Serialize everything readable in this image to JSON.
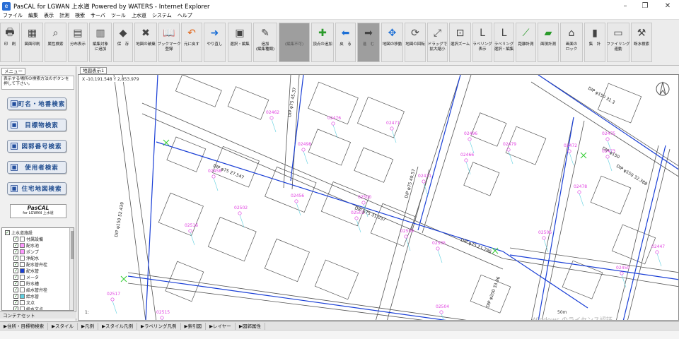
{
  "window": {
    "title": "PasCAL for LGWAN 上水道 Powered by WATERS - Internet Explorer",
    "controls": [
      "minimize-button",
      "restore-button",
      "close-button"
    ]
  },
  "menu": [
    "ファイル",
    "編集",
    "表示",
    "計測",
    "検索",
    "サーバ",
    "ツール",
    "上水道",
    "システム",
    "ヘルプ"
  ],
  "toolbar": [
    {
      "id": "print",
      "label": "印　刷",
      "icon": "printer-icon"
    },
    {
      "id": "mapprint",
      "label": "図面印刷",
      "icon": "map-print-icon"
    },
    {
      "id": "attr",
      "label": "属性検索",
      "icon": "attribute-search-icon"
    },
    {
      "id": "dist",
      "label": "分布表示",
      "icon": "distribution-icon"
    },
    {
      "id": "editadd",
      "label": "編集対象\nに追加",
      "icon": "edit-target-icon"
    },
    {
      "id": "save",
      "label": "保　存",
      "icon": "save-icon"
    },
    {
      "id": "clearmap",
      "label": "地図の破棄",
      "icon": "clear-map-icon"
    },
    {
      "id": "bookmark",
      "label": "ブックマーク\n登録",
      "icon": "bookmark-icon"
    },
    {
      "id": "undo",
      "label": "元に戻す",
      "icon": "undo-icon"
    },
    {
      "id": "redo",
      "label": "やり直し",
      "icon": "redo-icon"
    },
    {
      "id": "selectedit",
      "label": "選択・編集",
      "icon": "select-edit-icon"
    },
    {
      "id": "addedit",
      "label": "追加\n(編集種類)",
      "icon": "add-edit-icon"
    },
    {
      "id": "dis1",
      "label": "(編集不可)",
      "icon": "disabled-icon"
    },
    {
      "id": "vertex",
      "label": "頂点の追加",
      "icon": "add-vertex-icon"
    },
    {
      "id": "back",
      "label": "戻　る",
      "icon": "back-arrow-icon"
    },
    {
      "id": "forward",
      "label": "進　む",
      "icon": "forward-arrow-icon"
    },
    {
      "id": "move",
      "label": "地図の移動",
      "icon": "move-map-icon"
    },
    {
      "id": "rotate",
      "label": "地図の回転",
      "icon": "rotate-map-icon"
    },
    {
      "id": "dragzoom",
      "label": "ドラッグで\n拡大縮小",
      "icon": "drag-zoom-icon"
    },
    {
      "id": "selzoom",
      "label": "選択ズーム",
      "icon": "select-zoom-icon"
    },
    {
      "id": "labelshow",
      "label": "ラベリング\n表示",
      "icon": "label-show-icon"
    },
    {
      "id": "labeledit",
      "label": "ラベリング\n選択・編集",
      "icon": "label-edit-icon"
    },
    {
      "id": "distance",
      "label": "距離計測",
      "icon": "distance-measure-icon"
    },
    {
      "id": "area",
      "label": "面積計測",
      "icon": "area-measure-icon"
    },
    {
      "id": "lock",
      "label": "画面の\nロック",
      "icon": "screen-lock-icon"
    },
    {
      "id": "total",
      "label": "集　計",
      "icon": "tally-icon"
    },
    {
      "id": "filing",
      "label": "ファイリング\n連動",
      "icon": "filing-icon"
    },
    {
      "id": "leak",
      "label": "断水検索",
      "icon": "water-outage-search-icon"
    }
  ],
  "leftpane": {
    "tab": "メニュー",
    "instruction": "表示する場所の検索方法のボタンを押して下さい。",
    "buttons": [
      "町名・地番検索",
      "目標物検索",
      "図郭番号検索",
      "使用者検索",
      "住宅地図検索"
    ],
    "logo": {
      "line1": "PasCAL",
      "line2": "for LGWAN",
      "line3": "上水道"
    },
    "tree": [
      {
        "label": "上水道施設",
        "level": 0,
        "checked": true,
        "swatch": ""
      },
      {
        "label": "付属設備",
        "level": 1,
        "checked": true,
        "swatch": "#ffffff"
      },
      {
        "label": "配水池",
        "level": 1,
        "checked": true,
        "swatch": "#ff99ff"
      },
      {
        "label": "ポンプ",
        "level": 1,
        "checked": true,
        "swatch": "#ff99ff"
      },
      {
        "label": "浄配水",
        "level": 1,
        "checked": true,
        "swatch": "#ffffff"
      },
      {
        "label": "配水管弁栓",
        "level": 1,
        "checked": true,
        "swatch": "#ffffff"
      },
      {
        "label": "配水管",
        "level": 1,
        "checked": true,
        "swatch": "#1a3fd6"
      },
      {
        "label": "メータ",
        "level": 1,
        "checked": true,
        "swatch": "#ffffff"
      },
      {
        "label": "貯水槽",
        "level": 1,
        "checked": true,
        "swatch": "#ffffff"
      },
      {
        "label": "給水管弁栓",
        "level": 1,
        "checked": true,
        "swatch": "#ffffff"
      },
      {
        "label": "給水管",
        "level": 1,
        "checked": true,
        "swatch": "#5fd0e0"
      },
      {
        "label": "文点",
        "level": 1,
        "checked": true,
        "swatch": "#ffffff"
      },
      {
        "label": "給水文点",
        "level": 1,
        "checked": true,
        "swatch": "#ffffff"
      }
    ],
    "contents": "コンテナセット"
  },
  "map": {
    "tab": "地図表示1",
    "coords": "X -10,191.548 Y 2,853.979",
    "scale_left": "1:",
    "scale_meter": "50m",
    "watermark": "Windows のライセンス認証",
    "pipe_labels": [
      {
        "text": "DIP φ75 27.547",
        "color": "#1a3fd6"
      },
      {
        "text": "DIP φ75 31.037",
        "color": "#1a3fd6"
      },
      {
        "text": "DIP φ75 21.786",
        "color": "#1a3fd6"
      },
      {
        "text": "DIP φ150 31.3",
        "color": "#1a3fd6"
      },
      {
        "text": "DIP φ150 32.388",
        "color": "#1a3fd6"
      },
      {
        "text": "DIP φ75 45.37",
        "color": "#1a3fd6"
      },
      {
        "text": "DIP φ75 49.57",
        "color": "#1a3fd6"
      },
      {
        "text": "DIP φ150 52.439",
        "color": "#1a3fd6"
      },
      {
        "text": "DIP φ200 33.96",
        "color": "#1a3fd6"
      },
      {
        "text": "DIP φ150",
        "color": "#1a3fd6"
      }
    ],
    "meter_labels": [
      "02462",
      "02476",
      "02498",
      "02471",
      "02496",
      "02458",
      "02471",
      "02472",
      "02473",
      "02456",
      "02501",
      "02509",
      "02505",
      "02506",
      "02504",
      "02517",
      "02515",
      "02516",
      "02447",
      "02450",
      "02478",
      "02466",
      "02475",
      "02502",
      "02500",
      "02479"
    ]
  },
  "bottombar": [
    "住所・目標物検索",
    "スタイル",
    "凡例",
    "スタイル凡例",
    "ラベリング凡例",
    "索引図",
    "レイヤー",
    "図郭属性"
  ],
  "colors": {
    "pipe": "#1a3fd6",
    "service": "#5fd0e0",
    "label": "#e040e0",
    "valve": "#33cc33",
    "building": "#555555"
  }
}
